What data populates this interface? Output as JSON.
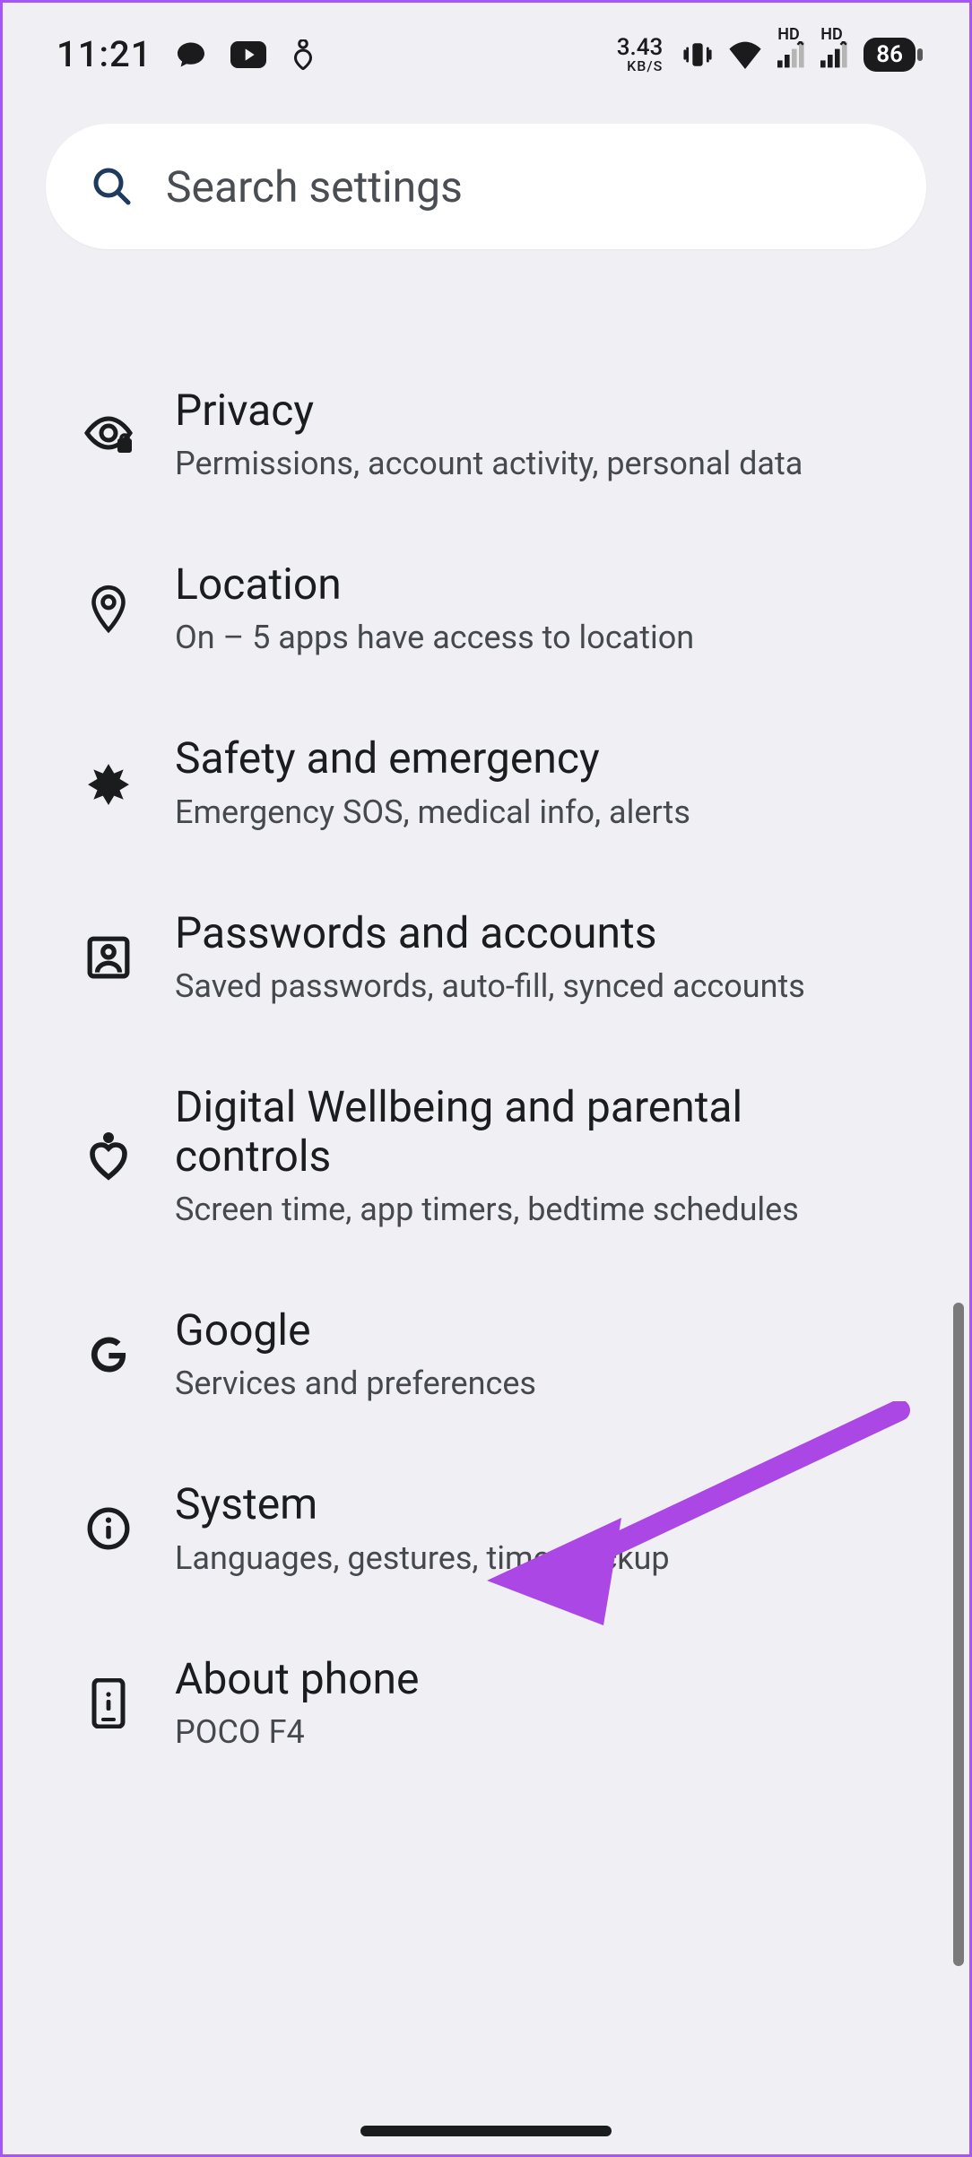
{
  "status": {
    "time": "11:21",
    "net_speed_value": "3.43",
    "net_speed_unit": "KB/S",
    "battery_level": "86",
    "signal_text_1": "HD",
    "signal_text_2": "HD"
  },
  "search": {
    "placeholder": "Search settings"
  },
  "settings": {
    "privacy": {
      "title": "Privacy",
      "subtitle": "Permissions, account activity, personal data"
    },
    "location": {
      "title": "Location",
      "subtitle": "On – 5 apps have access to location"
    },
    "safety": {
      "title": "Safety and emergency",
      "subtitle": "Emergency SOS, medical info, alerts"
    },
    "passwords": {
      "title": "Passwords and accounts",
      "subtitle": "Saved passwords, auto-fill, synced accounts"
    },
    "wellbeing": {
      "title": "Digital Wellbeing and parental controls",
      "subtitle": "Screen time, app timers, bedtime schedules"
    },
    "google": {
      "title": "Google",
      "subtitle": "Services and preferences"
    },
    "system": {
      "title": "System",
      "subtitle": "Languages, gestures, time, backup"
    },
    "about": {
      "title": "About phone",
      "subtitle": "POCO F4"
    }
  },
  "annotation": {
    "color": "#ab47e5"
  }
}
